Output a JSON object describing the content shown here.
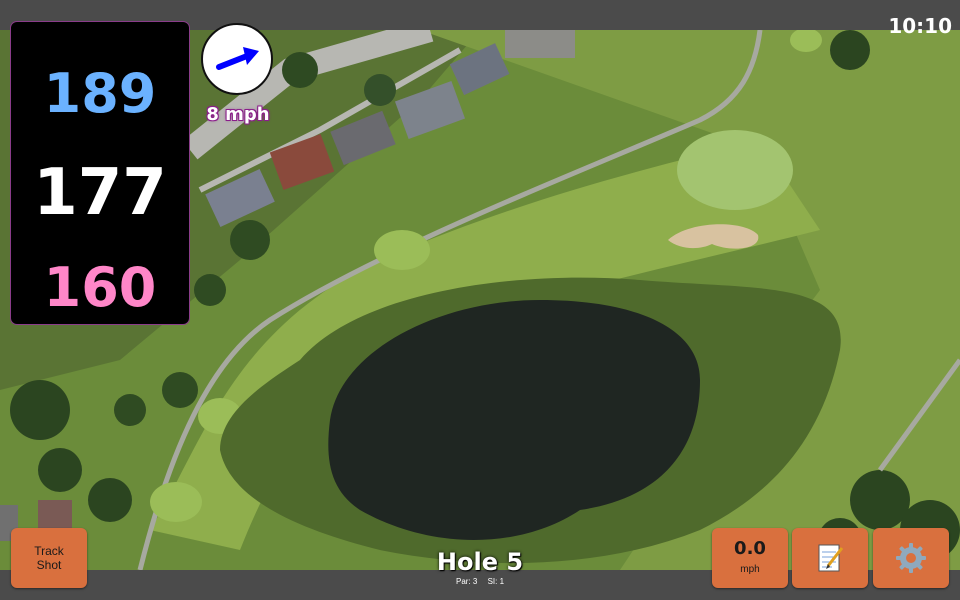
{
  "status": {
    "clock": "10:10"
  },
  "distances": {
    "back": "189",
    "middle": "177",
    "front": "160"
  },
  "wind": {
    "speed": "8 mph",
    "arrow_icon": "arrow-right-icon"
  },
  "buttons": {
    "track_shot": {
      "line1": "Track",
      "line2": "Shot"
    },
    "speed": {
      "value": "0.0",
      "unit": "mph"
    },
    "notes": {
      "icon": "notepad-icon"
    },
    "settings": {
      "icon": "gear-icon"
    }
  },
  "hole": {
    "title": "Hole 5",
    "par_label": "Par: 3",
    "si_label": "SI: 1"
  },
  "colors": {
    "accent_button": "#d9703e",
    "back_distance": "#6bb2ff",
    "mid_distance": "#ffffff",
    "front_distance": "#ff86c8",
    "bar": "#4b4b4b"
  }
}
